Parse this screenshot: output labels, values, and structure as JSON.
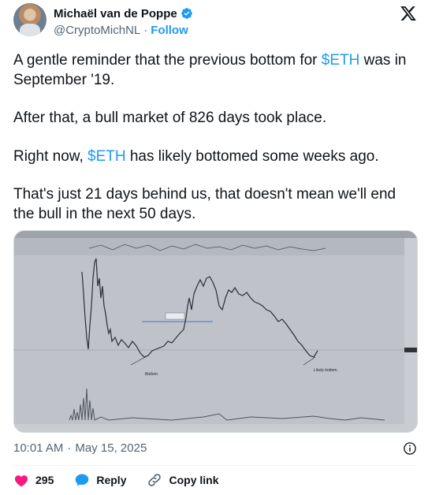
{
  "author": {
    "name": "Michaël van de Poppe",
    "handle": "@CryptoMichNL",
    "separator": "·",
    "follow_label": "Follow"
  },
  "tweet": {
    "line1_pre": "A gentle reminder that the previous bottom for ",
    "line1_tag": "$ETH",
    "line1_post": " was in September '19.",
    "para2": "After that, a bull market of 826 days took place.",
    "para3_pre": "Right now, ",
    "para3_tag": "$ETH",
    "para3_post": " has likely bottomed some weeks ago.",
    "para4": "That's just 21 days behind us, that doesn't mean we'll end the bull in the next 50 days."
  },
  "chart": {
    "label_bottom": "Bottom.",
    "label_likely": "Likely bottom."
  },
  "meta": {
    "time": "10:01 AM",
    "separator": "·",
    "date": "May 15, 2025"
  },
  "actions": {
    "likes": "295",
    "reply_label": "Reply",
    "copy_link_label": "Copy link"
  },
  "colors": {
    "accent": "#1d9bf0",
    "like": "#f91880",
    "text_secondary": "#536471"
  },
  "icons": [
    "verified-badge-icon",
    "x-logo-icon",
    "info-icon",
    "heart-icon",
    "reply-icon",
    "link-icon"
  ]
}
